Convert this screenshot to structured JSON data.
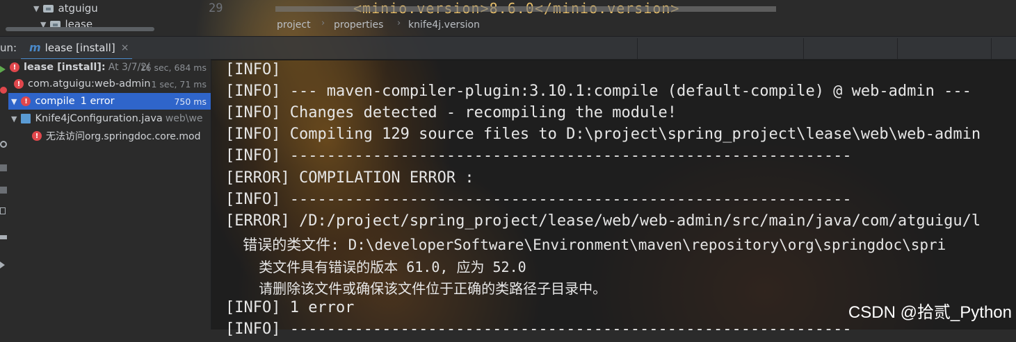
{
  "project_tree": {
    "items": [
      {
        "label": "atguigu"
      },
      {
        "label": "lease"
      }
    ]
  },
  "editor": {
    "line_number": "29",
    "code": "<minio.version>8.6.0</minio.version>",
    "breadcrumb": [
      "project",
      "properties",
      "knife4j.version"
    ]
  },
  "run_window": {
    "label": "un:",
    "tab_icon": "m",
    "tab_label": "lease [install]",
    "close": "×"
  },
  "build_tree": {
    "rows": [
      {
        "label": "lease [install]:",
        "detail": "At 3/7/2(",
        "timer": "16 sec, 684 ms"
      },
      {
        "label": "com.atguigu:web-admin",
        "detail": "",
        "timer": "1 sec, 71 ms"
      },
      {
        "label": "compile",
        "detail": "1 error",
        "timer": "750 ms"
      },
      {
        "label": "Knife4jConfiguration.java",
        "detail": "web\\we",
        "timer": ""
      },
      {
        "label": "无法访问org.springdoc.core.mod",
        "detail": "",
        "timer": ""
      }
    ]
  },
  "console": {
    "lines": [
      "[INFO]",
      "[INFO] --- maven-compiler-plugin:3.10.1:compile (default-compile) @ web-admin ---",
      "[INFO] Changes detected - recompiling the module!",
      "[INFO] Compiling 129 source files to D:\\project\\spring_project\\lease\\web\\web-admin",
      "[INFO] -------------------------------------------------------------",
      "[ERROR] COMPILATION ERROR :",
      "[INFO] -------------------------------------------------------------",
      "[ERROR] /D:/project/spring_project/lease/web/web-admin/src/main/java/com/atguigu/l",
      "  错误的类文件: D:\\developerSoftware\\Environment\\maven\\repository\\org\\springdoc\\spri",
      "    类文件具有错误的版本 61.0, 应为 52.0",
      "    请删除该文件或确保该文件位于正确的类路径子目录中。",
      "[INFO] 1 error",
      "[INFO] -------------------------------------------------------------"
    ]
  },
  "watermark": "CSDN @拾贰_Python",
  "colors": {
    "accent": "#2f65ca",
    "error": "#e0474c",
    "tab_underline": "#4a88c7"
  }
}
